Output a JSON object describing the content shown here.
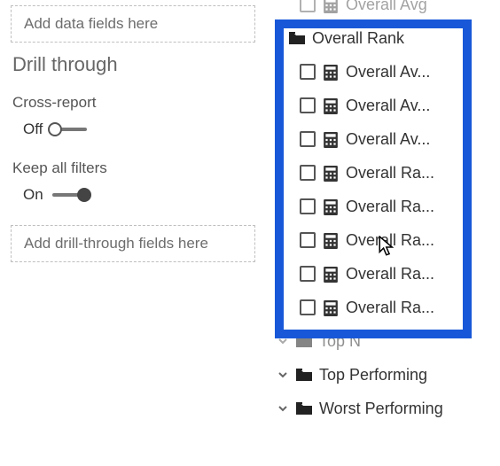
{
  "left": {
    "add_data_placeholder": "Add data fields here",
    "drill_section_title": "Drill through",
    "cross_report_label": "Cross-report",
    "cross_report_state": "Off",
    "keep_filters_label": "Keep all filters",
    "keep_filters_state": "On",
    "add_drill_placeholder": "Add drill-through fields here"
  },
  "fields": {
    "top_partial": {
      "label": "Overall Avg"
    },
    "group": {
      "name": "Overall Rank",
      "children": [
        {
          "label": "Overall Av..."
        },
        {
          "label": "Overall Av..."
        },
        {
          "label": "Overall Av..."
        },
        {
          "label": "Overall Ra..."
        },
        {
          "label": "Overall Ra..."
        },
        {
          "label": "Overall Ra..."
        },
        {
          "label": "Overall Ra..."
        },
        {
          "label": "Overall Ra..."
        }
      ]
    },
    "folders_below": [
      {
        "name": "Top N"
      },
      {
        "name": "Top Performing"
      },
      {
        "name": "Worst Performing"
      }
    ]
  },
  "cursor_child_index": 4
}
